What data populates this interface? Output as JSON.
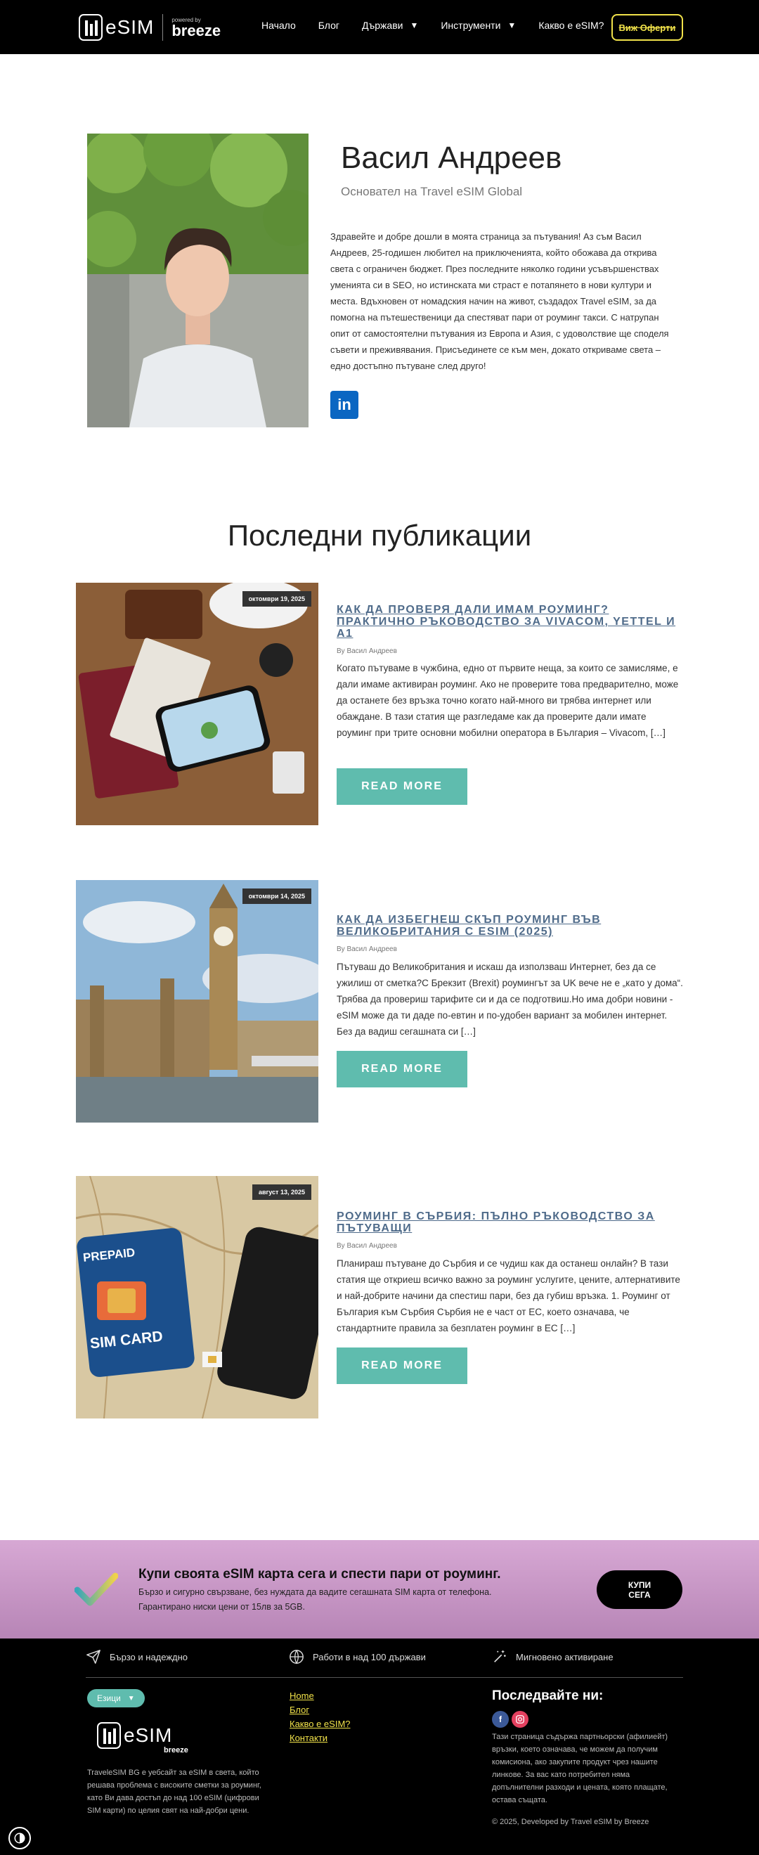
{
  "header": {
    "logo_text": "eSIM",
    "powered_by": "powered by",
    "partner": "breeze",
    "nav": [
      {
        "label": "Начало"
      },
      {
        "label": "Блог"
      },
      {
        "label": "Държави"
      },
      {
        "label": "Инструменти"
      },
      {
        "label": "Какво е eSIM?"
      }
    ],
    "cta": "Виж Оферти"
  },
  "profile": {
    "name": "Васил Андреев",
    "role": "Основател на Travel eSIM Global",
    "bio": "Здравейте и добре дошли в моята страница за пътувания! Аз съм Васил Андреев, 25-годишен любител на приключенията, който обожава да открива света с ограничен бюджет. През последните няколко години усъвършенствах уменията си в SEO, но истинската ми страст е потапянето в нови култури и места. Вдъхновен от номадския начин на живот, създадох Travel eSIM, за да помогна на пътешественици да спестяват пари от роуминг такси. С натрупан опит от самостоятелни пътувания из Европа и Азия, с удоволствие ще споделя съвети и преживявания. Присъединете се към мен, докато откриваме света – едно достъпно пътуване след друго!",
    "linkedin_icon": "linkedin-icon"
  },
  "section_title": "Последни публикации",
  "posts": [
    {
      "date": "октомври 19, 2025",
      "title": "КАК ДА ПРОВЕРЯ ДАЛИ ИМАМ РОУМИНГ? ПРАКТИЧНО РЪКОВОДСТВО ЗА VIVACOM, YETTEL И A1",
      "author": "By Васил Андреев",
      "excerpt": "Когато пътуваме в чужбина, едно от първите неща, за които се замисляме, е дали имаме активиран роуминг. Ако не проверите това предварително, може да останете без връзка точно когато най-много ви трябва интернет или обаждане. В тази статия ще разгледаме как да проверите дали имате роуминг при трите основни мобилни оператора в България – Vivacom, […]",
      "read_more": "READ MORE"
    },
    {
      "date": "октомври 14, 2025",
      "title": "КАК ДА ИЗБЕГНЕШ СКЪП РОУМИНГ ВЪВ ВЕЛИКОБРИТАНИЯ С ESIM (2025)",
      "author": "By Васил Андреев",
      "excerpt": "Пътуваш до Великобритания и искаш да използваш Интернет, без да се ужилиш от сметка?С Брекзит (Brexit) роумингът за UK вече не е „като у дома“. Трябва да провериш тарифите си и да се подготвиш.Но има добри новини - eSIM може да ти даде по-евтин и по-удобен вариант за мобилен интернет. Без да вадиш сегашната си […]",
      "read_more": "READ MORE"
    },
    {
      "date": "август 13, 2025",
      "title": "РОУМИНГ В СЪРБИЯ: ПЪЛНО РЪКОВОДСТВО ЗА ПЪТУВАЩИ",
      "author": "By Васил Андреев",
      "excerpt": "Планираш пътуване до Сърбия и се чудиш как да останеш онлайн? В тази статия ще откриеш всичко важно за роуминг услугите, цените, алтернативите и най-добрите начини да спестиш пари, без да губиш връзка. 1. Роуминг от България към Сърбия Сърбия не е част от ЕС, което означава, че стандартните правила за безплатен роуминг в ЕС […]",
      "read_more": "READ MORE",
      "image_texts": {
        "prepaid": "PREPAID",
        "sim": "SIM CARD"
      }
    }
  ],
  "cta_band": {
    "title": "Купи своята eSIM карта сега и спести пари от роуминг.",
    "subtitle": "Бързо и сигурно свързване, без нуждата да вадите сегашната SIM карта от телефона. Гарантирано ниски цени от 15лв за 5GB.",
    "button": "КУПИ СЕГА"
  },
  "footer": {
    "features": [
      {
        "icon": "send-icon",
        "label": "Бързо и надеждно"
      },
      {
        "icon": "globe-icon",
        "label": "Работи в над 100 държави"
      },
      {
        "icon": "magic-wand-icon",
        "label": "Мигновено активиране"
      }
    ],
    "language_button": "Езици",
    "description": "TravelеSIM BG е уебсайт за eSIM в света, който решава проблема с високите сметки за роуминг, като Ви дава достъп до над 100 eSIM (цифрови SIM карти) по целия свят на най-добри цени.",
    "links": [
      "Home",
      "Блог",
      "Какво е eSIM?",
      "Контакти"
    ],
    "follow_title": "Последвайте ни:",
    "disclaimer": "Тази страница съдържа партньорски (афилиейт) връзки, което означава, че можем да получим комисиона, ако закупите продукт чрез нашите линкове. За вас като потребител няма допълнителни разходи и цената, която плащате, остава същата.",
    "copyright": "© 2025, Developed by Travel eSIM by Breeze"
  }
}
